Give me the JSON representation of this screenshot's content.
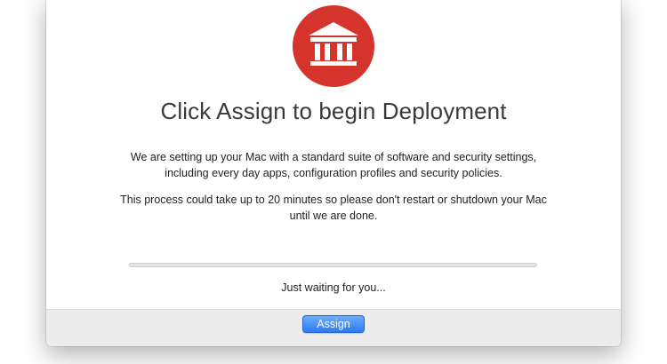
{
  "dialog": {
    "logo_icon": "bank-building-icon",
    "title": "Click Assign to begin Deployment",
    "paragraph1": "We are setting up your Mac with a standard suite of software and security settings, including every day apps, configuration profiles and security policies.",
    "paragraph2": "This process could take up to 20 minutes so please don't restart or shutdown your Mac until we are done.",
    "progress": 0,
    "status_text": "Just waiting for you...",
    "assign_label": "Assign"
  },
  "colors": {
    "logo_red": "#d5342c",
    "button_blue": "#2c7bf2",
    "footer_gray": "#ececec"
  }
}
